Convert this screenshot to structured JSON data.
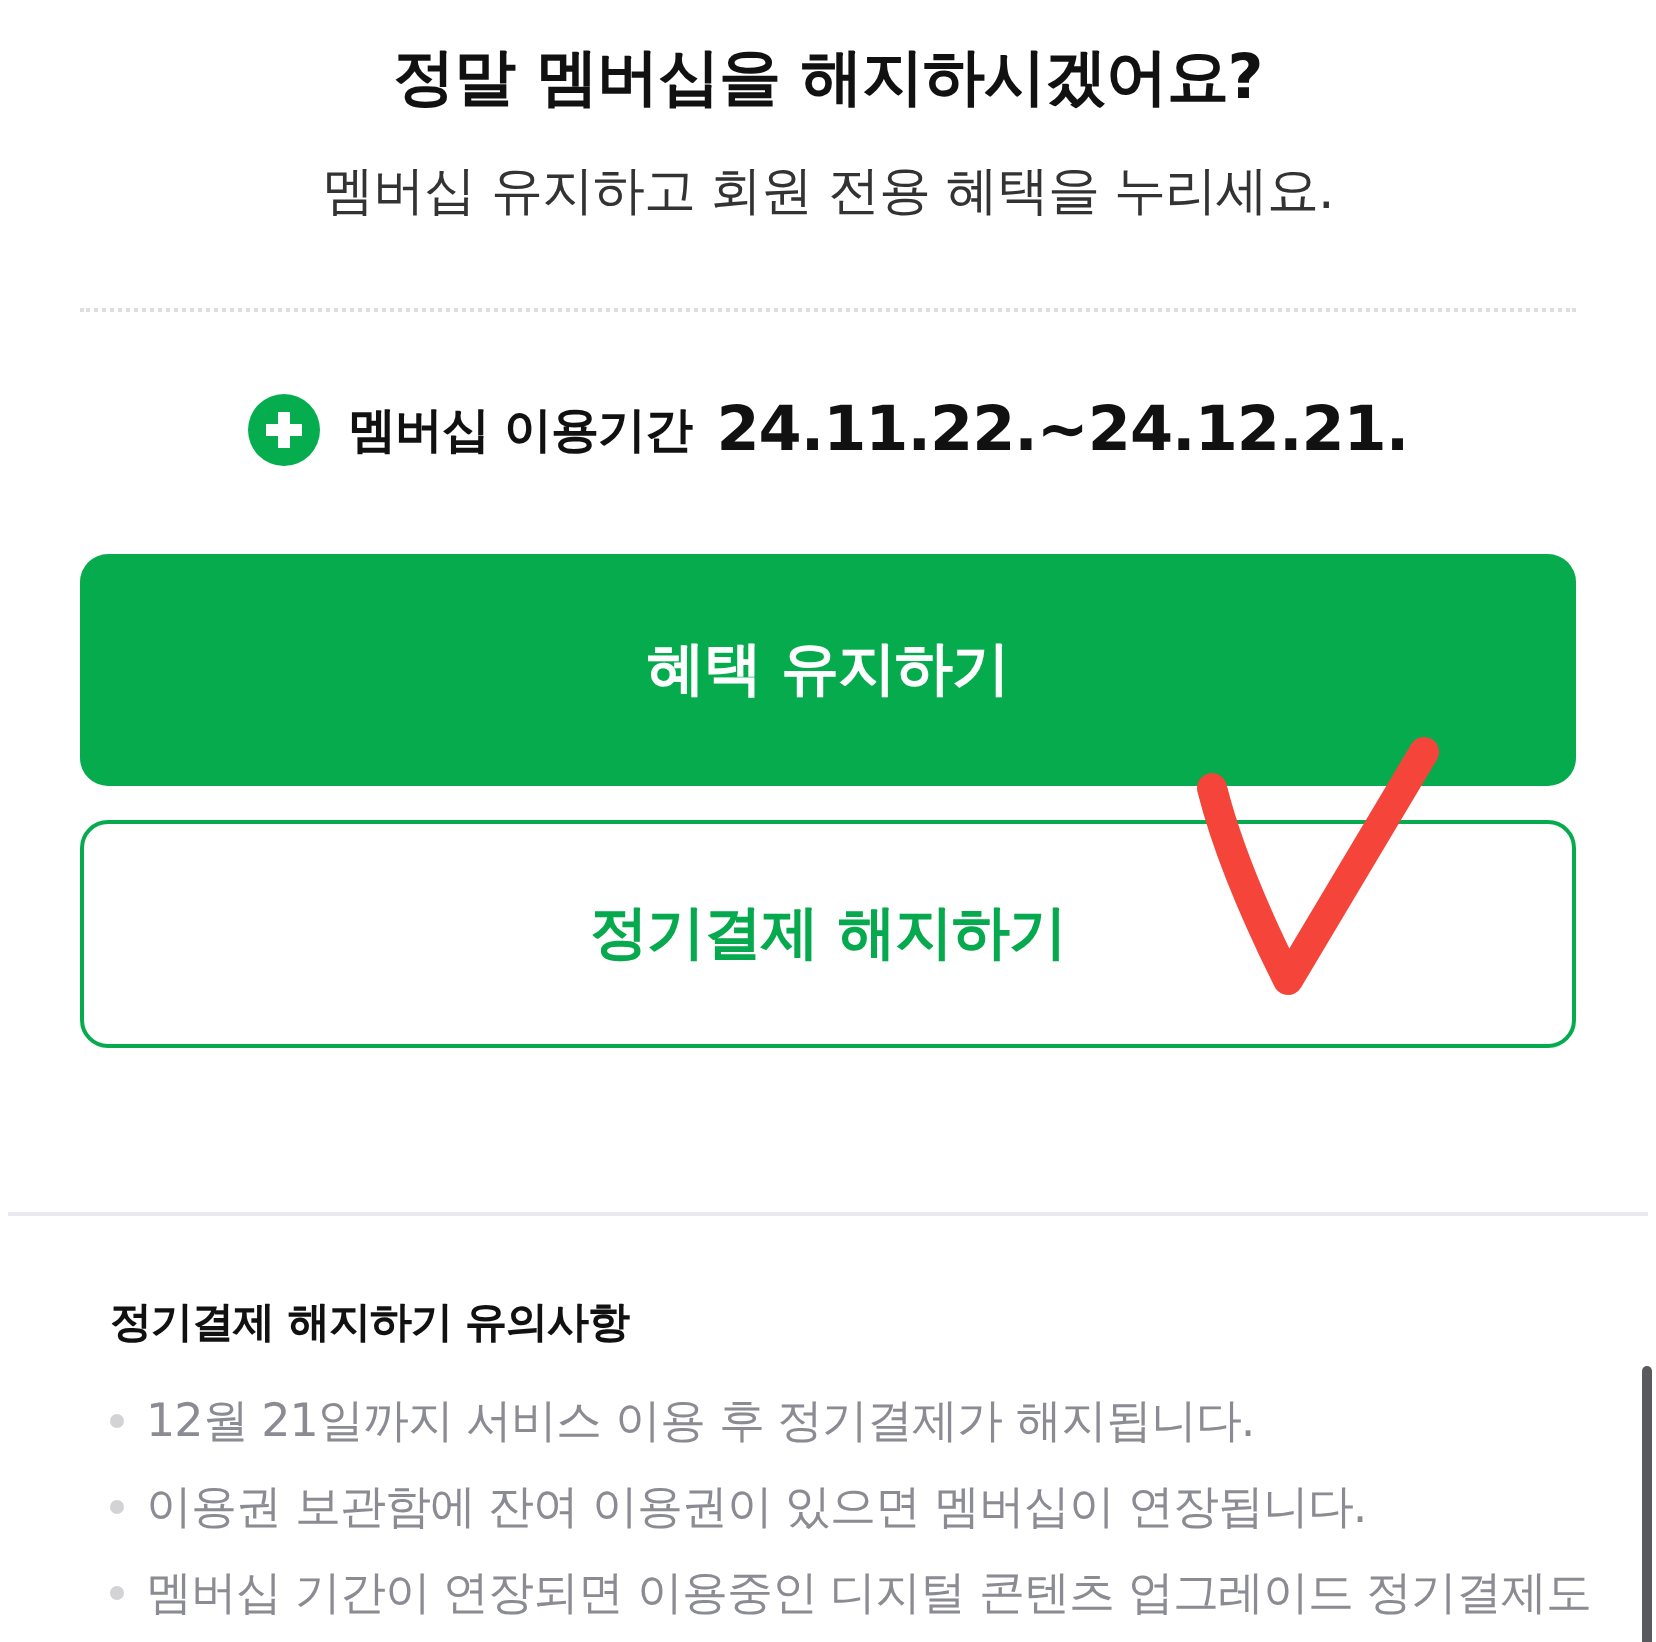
{
  "title": "정말 멤버십을 해지하시겠어요?",
  "subtitle": "멤버십 유지하고 회원 전용 혜택을 누리세요.",
  "period": {
    "label": "멤버십 이용기간",
    "dates": "24.11.22.~24.12.21."
  },
  "buttons": [
    {
      "label": "혜택 유지하기",
      "kind": "primary"
    },
    {
      "label": "정기결제 해지하기",
      "kind": "outline"
    }
  ],
  "notice": {
    "title": "정기결제 해지하기 유의사항",
    "items": [
      "12월 21일까지 서비스 이용 후 정기결제가 해지됩니다.",
      "이용권 보관함에 잔여 이용권이 있으면 멤버십이 연장됩니다.",
      "멤버십 기간이 연장되면 이용중인 디지털 콘텐츠 업그레이드 정기결제도"
    ]
  }
}
